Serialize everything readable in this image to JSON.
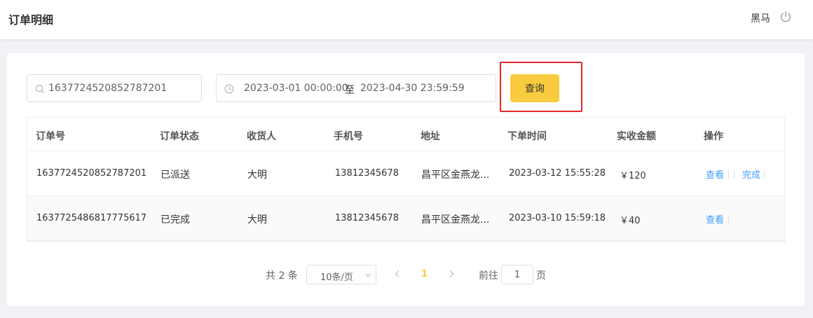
{
  "header": {
    "title": "订单明细",
    "user": "黑马",
    "power_icon": "power-icon"
  },
  "search": {
    "value": "1637724520852787201",
    "icon": "search-icon"
  },
  "date_range": {
    "start": "2023-03-01 00:00:00",
    "separator": "至",
    "end": "2023-04-30 23:59:59",
    "icon": "clock-icon"
  },
  "query_button": {
    "label": "查询"
  },
  "colors": {
    "accent": "#f9cb3f",
    "link": "#409eff",
    "highlight_border": "#e8262e"
  },
  "table": {
    "columns": [
      "订单号",
      "订单状态",
      "收货人",
      "手机号",
      "地址",
      "下单时间",
      "实收金额",
      "操作"
    ],
    "rows": [
      {
        "order_no": "1637724520852787201",
        "status": "已派送",
        "consignee": "大明",
        "phone": "13812345678",
        "address": "昌平区金燕龙...",
        "time": "2023-03-12 15:55:28",
        "amount": "￥120",
        "actions": [
          "查看",
          "完成"
        ]
      },
      {
        "order_no": "1637725486817775617",
        "status": "已完成",
        "consignee": "大明",
        "phone": "13812345678",
        "address": "昌平区金燕龙...",
        "time": "2023-03-10 15:59:18",
        "amount": "￥40",
        "actions": [
          "查看"
        ]
      }
    ]
  },
  "pagination": {
    "total": "共 2 条",
    "page_size": "10条/页",
    "current_page": "1",
    "goto_label": "前往",
    "goto_value": "1",
    "page_suffix": "页"
  }
}
